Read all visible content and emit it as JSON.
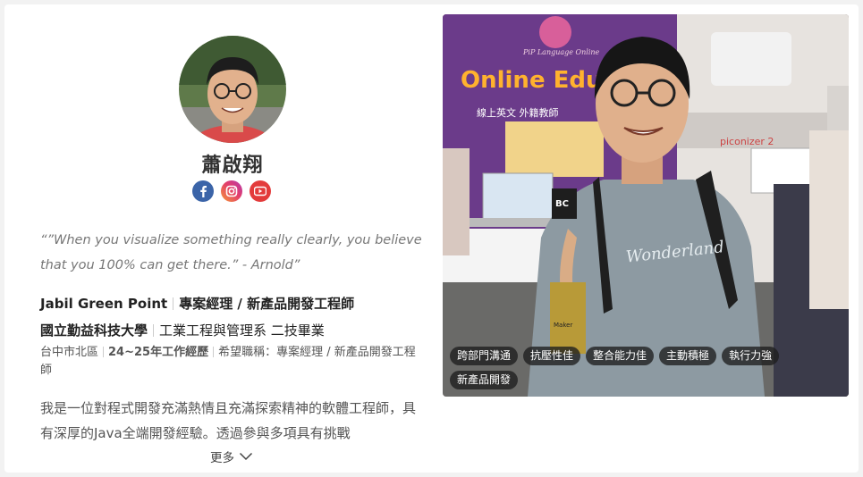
{
  "profile": {
    "name": "蕭啟翔",
    "socials": [
      {
        "icon": "facebook-icon"
      },
      {
        "icon": "instagram-icon"
      },
      {
        "icon": "youtube-icon"
      }
    ],
    "quote": "“”When you visualize something really clearly, you believe that you 100% can get there.” - Arnold”",
    "company": "Jabil Green Point",
    "job_title": "專案經理 / 新產品開發工程師",
    "school": "國立勤益科技大學",
    "department": "工業工程與管理系 二技畢業",
    "location": "台中市北區",
    "experience": "24~25年工作經歷",
    "desired_position": "希望職稱：專案經理 / 新產品開發工程師",
    "about": "我是一位對程式開發充滿熱情且充滿探索精神的軟體工程師，具有深厚的Java全端開發經驗。透過參與多項具有挑戰",
    "more_label": "更多"
  },
  "photo": {
    "tags": [
      "跨部門溝通",
      "抗壓性佳",
      "整合能力佳",
      "主動積極",
      "執行力強",
      "新產品開發"
    ],
    "booth_sign": "Online Edu",
    "booth_subtitle": "線上英文 外籍教師",
    "booth_logo": "PiP Language Online",
    "mic_label": "BC",
    "brand_sign": "piconizer 2",
    "trophy_label": "Maker"
  },
  "colors": {
    "facebook": "#3b64a8",
    "youtube": "#e33b3b",
    "tag_bg": "#1e1e1e"
  }
}
